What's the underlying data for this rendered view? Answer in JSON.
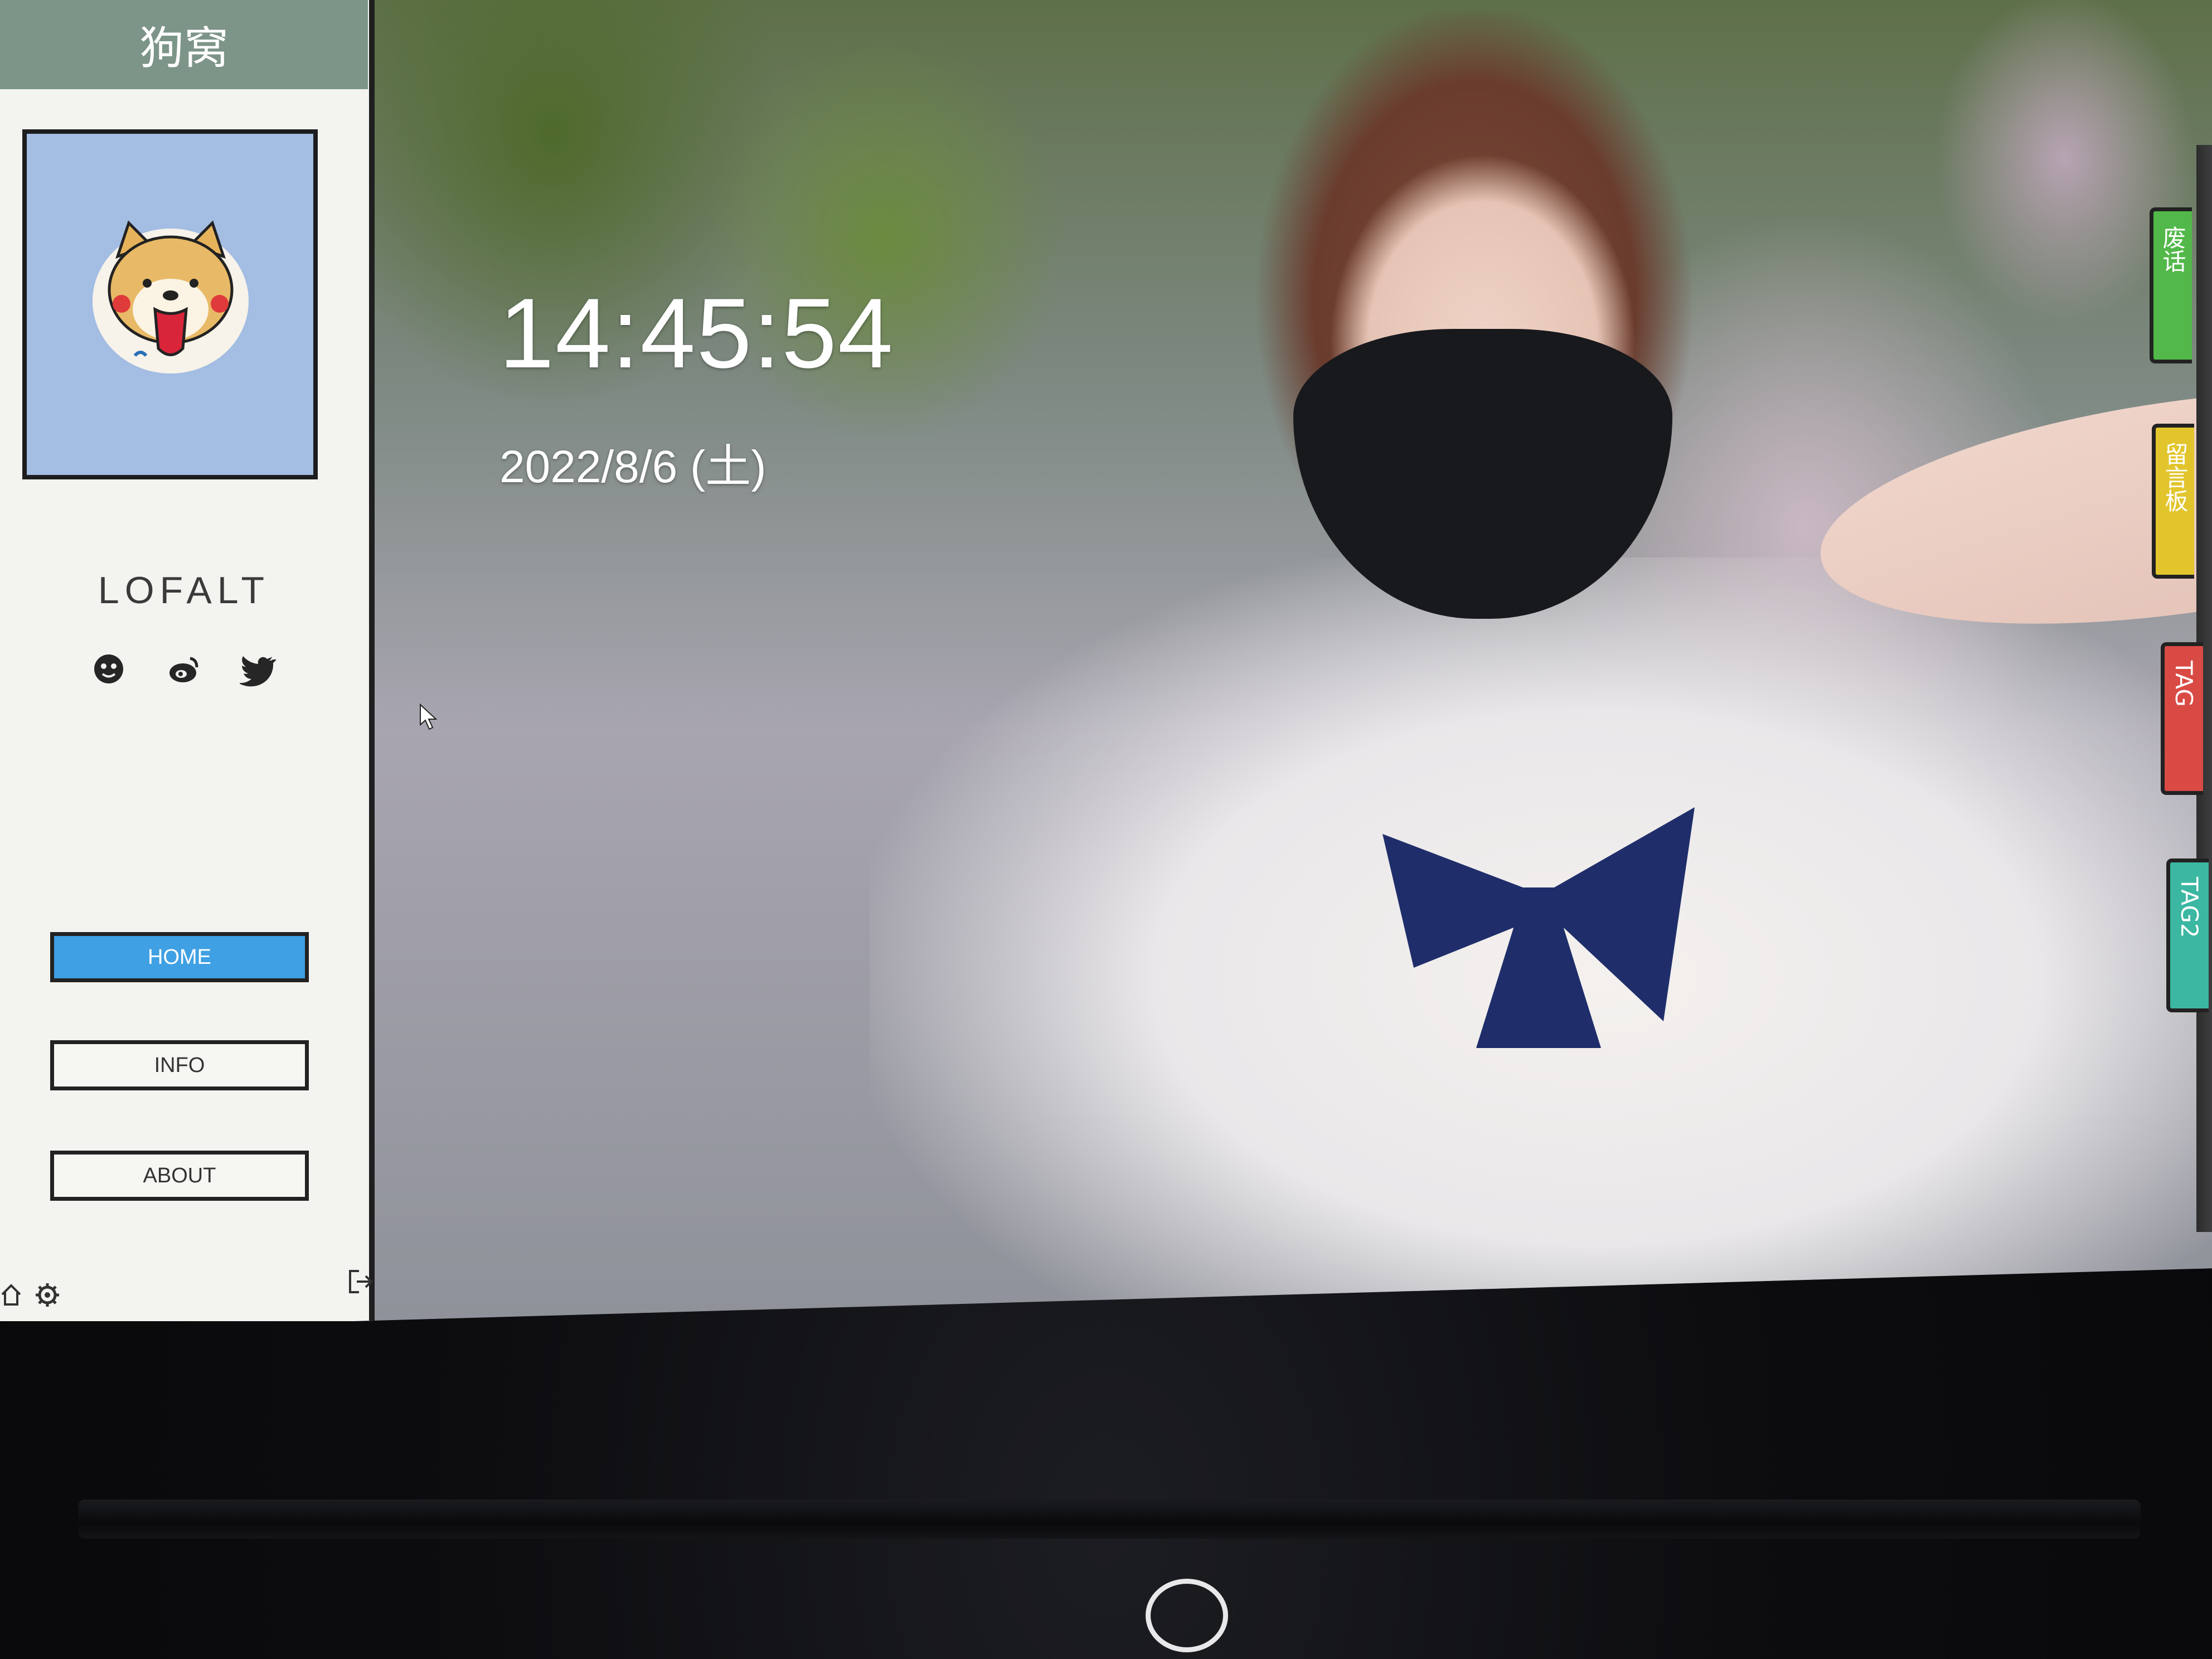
{
  "sidebar": {
    "site_title": "狗窝",
    "username": "LOFALT",
    "social_icons": [
      "face-icon",
      "weibo-icon",
      "twitter-icon"
    ],
    "nav": [
      {
        "label": "HOME",
        "active": true
      },
      {
        "label": "INFO",
        "active": false
      },
      {
        "label": "ABOUT",
        "active": false
      }
    ],
    "footer_icons": [
      "home-icon",
      "gear-icon",
      "logout-icon"
    ]
  },
  "clock": {
    "time": "14:45:54",
    "date": "2022/8/6 (土)"
  },
  "side_tabs": [
    {
      "label": "废话",
      "color": "#52b84a"
    },
    {
      "label": "留言板",
      "color": "#e2c52c"
    },
    {
      "label": "TAG",
      "color": "#d94a44"
    },
    {
      "label": "TAG2",
      "color": "#3bb7a2"
    }
  ],
  "colors": {
    "title_bar": "#7d9589",
    "avatar_bg": "#a3bde3",
    "active_nav": "#3fa0e3"
  }
}
